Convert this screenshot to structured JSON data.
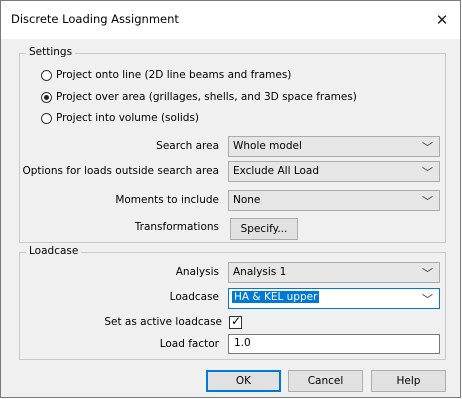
{
  "window": {
    "title": "Discrete Loading Assignment",
    "close_glyph": "✕"
  },
  "settings": {
    "legend": "Settings",
    "radios": [
      {
        "label": "Project onto line (2D line beams and frames)",
        "checked": false
      },
      {
        "label": "Project over area (grillages, shells, and 3D space frames)",
        "checked": true
      },
      {
        "label": "Project into volume (solids)",
        "checked": false
      }
    ],
    "search_area_label": "Search area",
    "search_area_value": "Whole model",
    "outside_label": "Options for loads outside search area",
    "outside_value": "Exclude All Load",
    "moments_label": "Moments to include",
    "moments_value": "None",
    "transformations_label": "Transformations",
    "specify_button": "Specify..."
  },
  "loadcase": {
    "legend": "Loadcase",
    "analysis_label": "Analysis",
    "analysis_value": "Analysis 1",
    "loadcase_label": "Loadcase",
    "loadcase_value": "HA & KEL upper",
    "active_label": "Set as active loadcase",
    "active_checked": true,
    "factor_label": "Load factor",
    "factor_value": "1.0"
  },
  "buttons": {
    "ok": "OK",
    "cancel": "Cancel",
    "help": "Help"
  },
  "icons": {
    "chevron": "chevron-down-icon",
    "check": "check-icon"
  }
}
